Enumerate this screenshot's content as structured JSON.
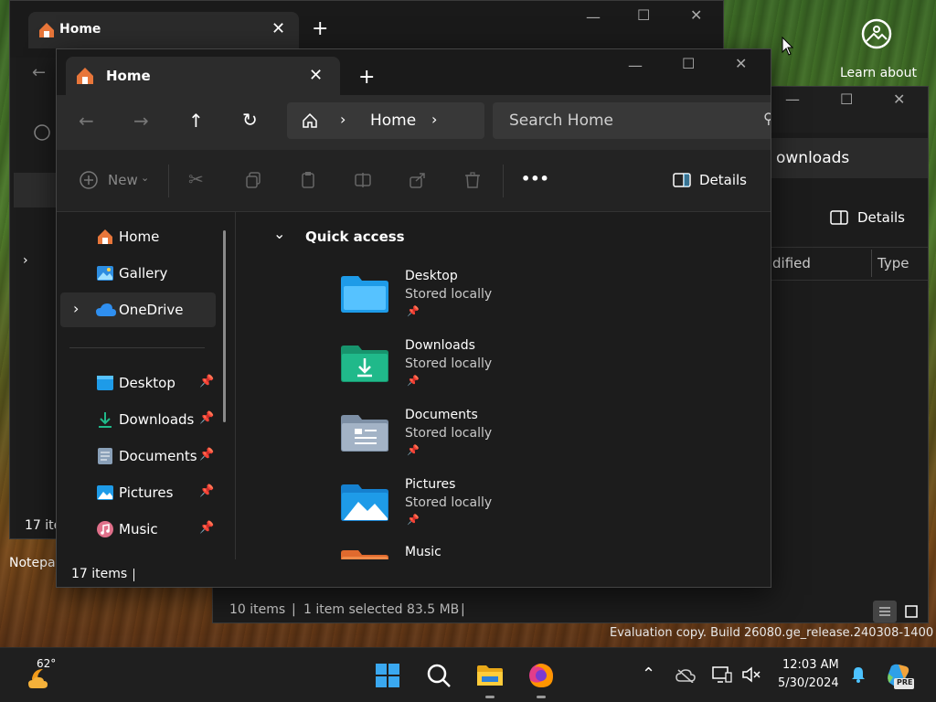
{
  "desktop": {
    "learn_about": "Learn about",
    "notepad_label": "Notepa",
    "watermark": "Evaluation copy. Build 26080.ge_release.240308-1400"
  },
  "back_window_1": {
    "tab_title": "Home",
    "status_items": "17 ite"
  },
  "back_window_2": {
    "address_text": "ownloads",
    "details_label": "Details",
    "col_modified": "dified",
    "col_type": "Type",
    "status_items": "10 items",
    "status_sep": "|",
    "status_selected": "1 item selected  83.5 MB"
  },
  "explorer": {
    "tab_title": "Home",
    "breadcrumb_home": "Home",
    "search_placeholder": "Search Home",
    "toolbar": {
      "new_label": "New",
      "more_label": "•••",
      "details_label": "Details"
    },
    "sidebar": {
      "items": [
        {
          "label": "Home"
        },
        {
          "label": "Gallery"
        },
        {
          "label": "OneDrive"
        }
      ],
      "pinned": [
        {
          "label": "Desktop"
        },
        {
          "label": "Downloads"
        },
        {
          "label": "Documents"
        },
        {
          "label": "Pictures"
        },
        {
          "label": "Music"
        }
      ]
    },
    "quick_access": {
      "title": "Quick access",
      "folders": [
        {
          "name": "Desktop",
          "status": "Stored locally",
          "icon": "desktop-folder-icon"
        },
        {
          "name": "Downloads",
          "status": "Stored locally",
          "icon": "downloads-folder-icon"
        },
        {
          "name": "Documents",
          "status": "Stored locally",
          "icon": "documents-folder-icon"
        },
        {
          "name": "Pictures",
          "status": "Stored locally",
          "icon": "pictures-folder-icon"
        },
        {
          "name": "Music",
          "status": "",
          "icon": "music-folder-icon"
        }
      ]
    },
    "status_items": "17 items"
  },
  "taskbar": {
    "temperature": "62°",
    "time": "12:03 AM",
    "date": "5/30/2024",
    "copilot_badge": "PRE"
  },
  "colors": {
    "accent_blue": "#4cc2ff",
    "folder_blue": "#1e9be8",
    "folder_green": "#20b98a",
    "home_orange": "#e8763a"
  }
}
